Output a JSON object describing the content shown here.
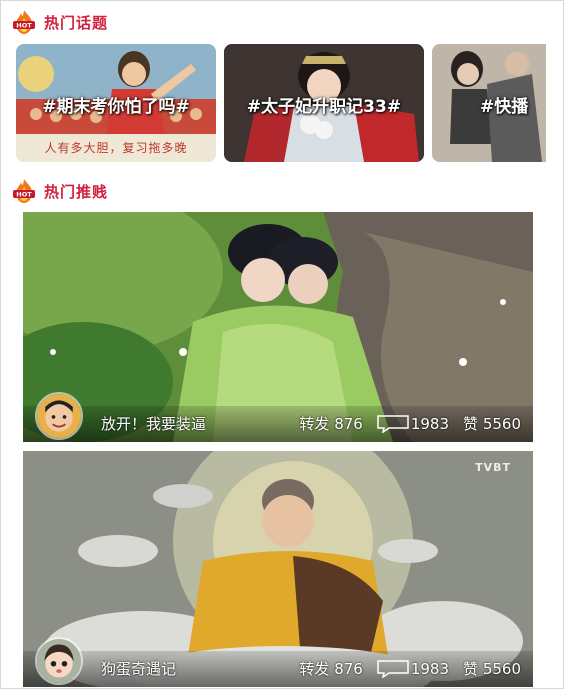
{
  "sections": {
    "topics_title": "热门话题",
    "recommend_title": "热门推贱"
  },
  "topics": [
    {
      "tag": "#期末考你怕了吗#",
      "subcaption": "人有多大胆，复习拖多晚"
    },
    {
      "tag": "#太子妃升职记33#",
      "subcaption": ""
    },
    {
      "tag": "#快播",
      "subcaption": ""
    }
  ],
  "posts": [
    {
      "author": "放开！我要装逼",
      "repost_label": "转发",
      "repost_count": "876",
      "comment_count": "1983",
      "like_label": "赞",
      "like_count": "5560",
      "watermark": ""
    },
    {
      "author": "狗蛋奇遇记",
      "repost_label": "转发",
      "repost_count": "876",
      "comment_count": "1983",
      "like_label": "赞",
      "like_count": "5560",
      "watermark": "TVBT"
    }
  ],
  "icons": {
    "hot_badge": "hot-flame-icon",
    "comment": "speech-bubble-icon"
  },
  "colors": {
    "accent": "#d4213f"
  }
}
